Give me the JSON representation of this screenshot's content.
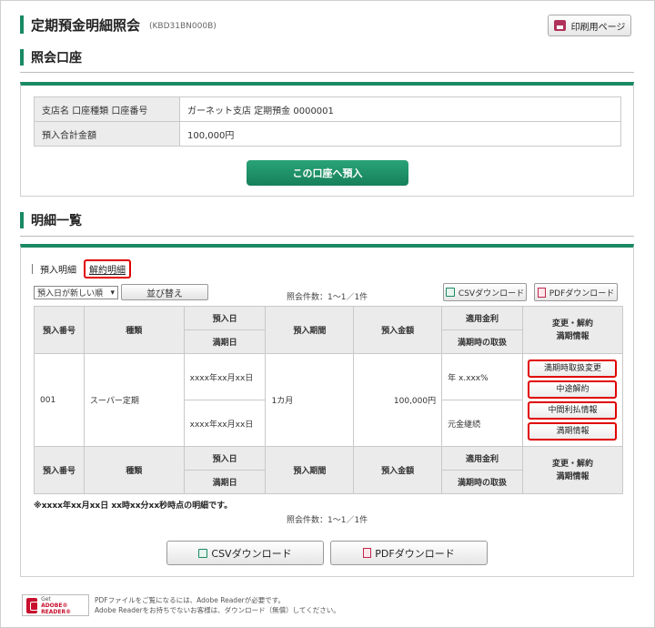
{
  "header": {
    "title": "定期預金明細照会",
    "code": "(KBD31BN000B)",
    "print_label": "印刷用ページ"
  },
  "account_section": {
    "title": "照会口座",
    "rows": [
      {
        "label": "支店名 口座種類 口座番号",
        "value": "ガーネット支店 定期預金 0000001"
      },
      {
        "label": "預入合計金額",
        "value": "100,000円"
      }
    ],
    "deposit_button": "この口座へ預入"
  },
  "detail_section": {
    "title": "明細一覧",
    "tab_active": "預入明細",
    "tab_link": "解約明細",
    "sort_select": "預入日が新しい順",
    "sort_button": "並び替え",
    "count_text": "照会件数：1～1／1件",
    "csv_small": "CSVダウンロード",
    "pdf_small": "PDFダウンロード",
    "headers": {
      "number": "預入番号",
      "type": "種類",
      "deposit_date": "預入日",
      "maturity_date": "満期日",
      "period": "預入期間",
      "amount": "預入金額",
      "rate": "適用金利",
      "maturity_handling": "満期時の取扱",
      "change_line1": "変更・解約",
      "change_line2": "満期情報"
    },
    "row": {
      "number": "001",
      "type": "スーパー定期",
      "deposit_date": "xxxx年xx月xx日",
      "maturity_date": "xxxx年xx月xx日",
      "period": "1カ月",
      "amount": "100,000円",
      "rate": "年 x.xxx%",
      "maturity_handling": "元金継続"
    },
    "actions": [
      "満期時取扱変更",
      "中途解約",
      "中間利払情報",
      "満期情報"
    ],
    "note": "※xxxx年xx月xx日 xx時xx分xx秒時点の明細です。",
    "csv_big": "CSVダウンロード",
    "pdf_big": "PDFダウンロード"
  },
  "footer": {
    "badge_line1": "Get",
    "badge_line2": "ADOBE® READER®",
    "note_line1": "PDFファイルをご覧になるには、Adobe Readerが必要です。",
    "note_line2": "Adobe Readerをお持ちでないお客様は、ダウンロード（無償）してください。"
  },
  "colors": {
    "accent": "#1a8a64",
    "highlight": "#e00000"
  }
}
